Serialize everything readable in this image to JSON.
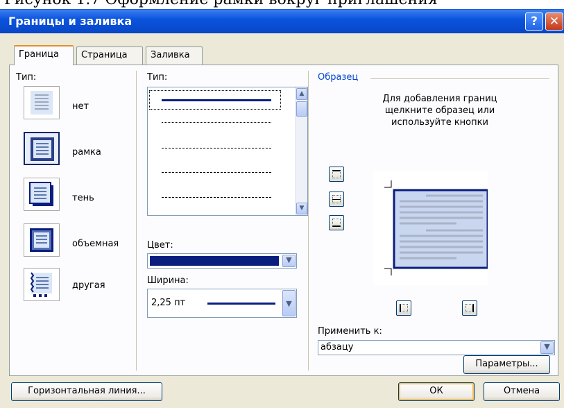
{
  "caption": "Рисунок 1.7 Оформление рамки вокруг приглашения",
  "window": {
    "title": "Границы и заливка",
    "help_label": "?",
    "close_label": "✕"
  },
  "tabs": [
    {
      "label": "Граница",
      "active": true
    },
    {
      "label": "Страница",
      "active": false
    },
    {
      "label": "Заливка",
      "active": false
    }
  ],
  "type_section": {
    "label": "Тип:",
    "items": [
      {
        "label": "нет",
        "icon": "border-none-icon"
      },
      {
        "label": "рамка",
        "icon": "border-box-icon",
        "selected": true
      },
      {
        "label": "тень",
        "icon": "border-shadow-icon"
      },
      {
        "label": "объемная",
        "icon": "border-3d-icon"
      },
      {
        "label": "другая",
        "icon": "border-custom-icon"
      }
    ]
  },
  "style_section": {
    "label": "Тип:",
    "styles": [
      "solid",
      "dotted",
      "dashed-fine",
      "dashed",
      "dash-dot"
    ],
    "selected_style": "solid"
  },
  "color": {
    "label": "Цвет:",
    "value": "#0a1e7e"
  },
  "width": {
    "label": "Ширина:",
    "value": "2,25 пт"
  },
  "preview": {
    "group_label": "Образец",
    "instruction": "Для добавления границ щелкните образец или используйте кнопки",
    "border_color": "#0a1e7e",
    "fill_color": "#c9d6ef"
  },
  "apply_to": {
    "label": "Применить к:",
    "value": "абзацу"
  },
  "buttons": {
    "options": "Параметры...",
    "horizontal_line": "Горизонтальная линия...",
    "ok": "ОК",
    "cancel": "Отмена"
  },
  "colors": {
    "accent": "#0a54de",
    "tab_highlight": "#e68b2c",
    "dialog_bg": "#ece9d8"
  }
}
